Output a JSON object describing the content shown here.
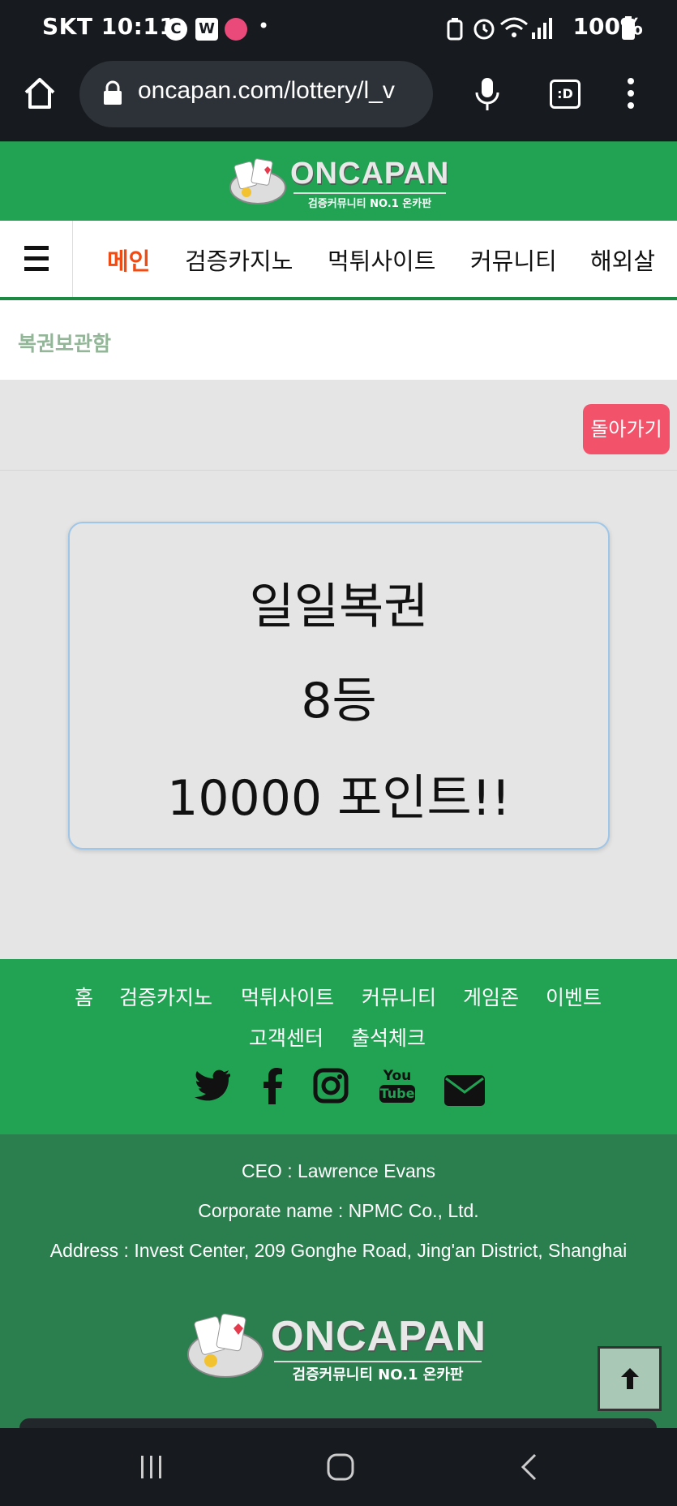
{
  "status_bar": {
    "carrier_time": "SKT 10:11",
    "app_icons": [
      "C",
      "W",
      "•"
    ],
    "battery": "100%"
  },
  "browser": {
    "url": "oncapan.com/lottery/l_v",
    "icons": [
      "home-icon",
      "lock-icon",
      "mic-icon",
      "tab-switcher-icon",
      "more-icon"
    ],
    "tab_label": ":D"
  },
  "header": {
    "logo_text": "ONCAPAN",
    "logo_sub": "검증커뮤니티 NO.1 온카판"
  },
  "nav": {
    "items": [
      {
        "label": "메인",
        "active": true
      },
      {
        "label": "검증카지노",
        "active": false
      },
      {
        "label": "먹튀사이트",
        "active": false
      },
      {
        "label": "커뮤니티",
        "active": false
      },
      {
        "label": "해외살",
        "active": false
      }
    ]
  },
  "breadcrumb": {
    "title": "복권보관함"
  },
  "actions": {
    "back_label": "돌아가기"
  },
  "result": {
    "line1": "일일복권",
    "line2": "8등",
    "line3": "10000 포인트!!"
  },
  "footer": {
    "links_row1": [
      "홈",
      "검증카지노",
      "먹튀사이트",
      "커뮤니티",
      "게임존",
      "이벤트"
    ],
    "links_row2": [
      "고객센터",
      "출석체크"
    ],
    "social": [
      "twitter-icon",
      "facebook-icon",
      "instagram-icon",
      "youtube-icon",
      "email-icon"
    ],
    "youtube_top": "You",
    "youtube_bottom": "Tube",
    "ceo": "CEO : Lawrence Evans",
    "corporate": "Corporate name : NPMC Co., Ltd.",
    "address": "Address : Invest Center, 209 Gonghe Road, Jing'an District, Shanghai",
    "logo_text": "ONCAPAN",
    "logo_sub": "검증커뮤니티 NO.1 온카판"
  },
  "colors": {
    "brand_green": "#22a354",
    "footer_dark_green": "#2b7f4e",
    "active_nav": "#f04b12",
    "back_button": "#f2536b"
  }
}
